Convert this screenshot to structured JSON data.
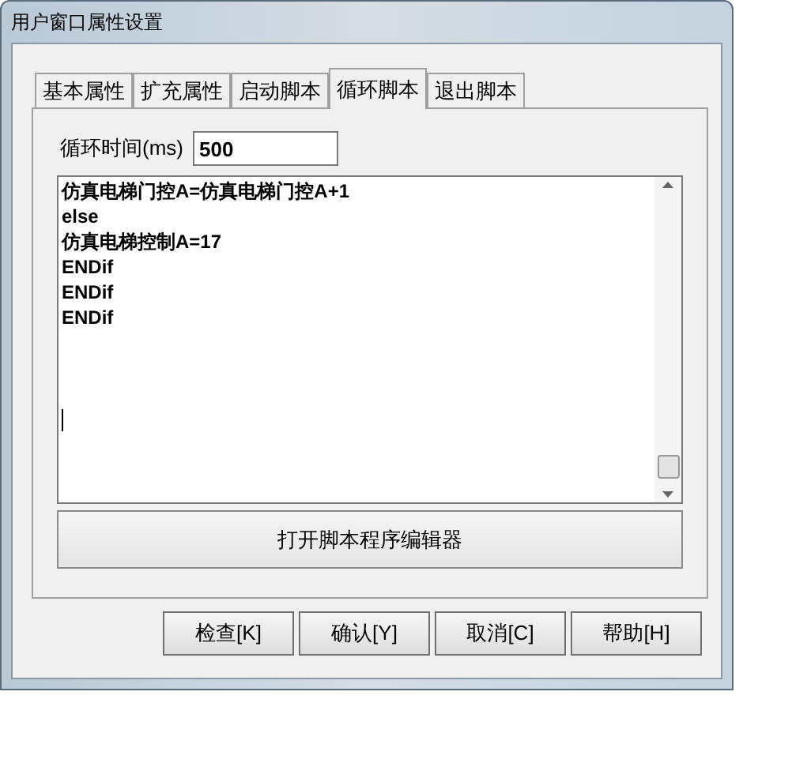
{
  "window": {
    "title": "用户窗口属性设置"
  },
  "tabs": [
    {
      "label": "基本属性",
      "selected": false
    },
    {
      "label": "扩充属性",
      "selected": false
    },
    {
      "label": "启动脚本",
      "selected": false
    },
    {
      "label": "循环脚本",
      "selected": true
    },
    {
      "label": "退出脚本",
      "selected": false
    }
  ],
  "interval": {
    "label": "循环时间(ms)",
    "value": "500"
  },
  "script_lines": [
    "仿真电梯门控A=仿真电梯门控A+1",
    "else",
    "仿真电梯控制A=17",
    "ENDif",
    "ENDif",
    "ENDif"
  ],
  "editor_button": "打开脚本程序编辑器",
  "buttons": [
    "检查[K]",
    "确认[Y]",
    "取消[C]",
    "帮助[H]"
  ]
}
